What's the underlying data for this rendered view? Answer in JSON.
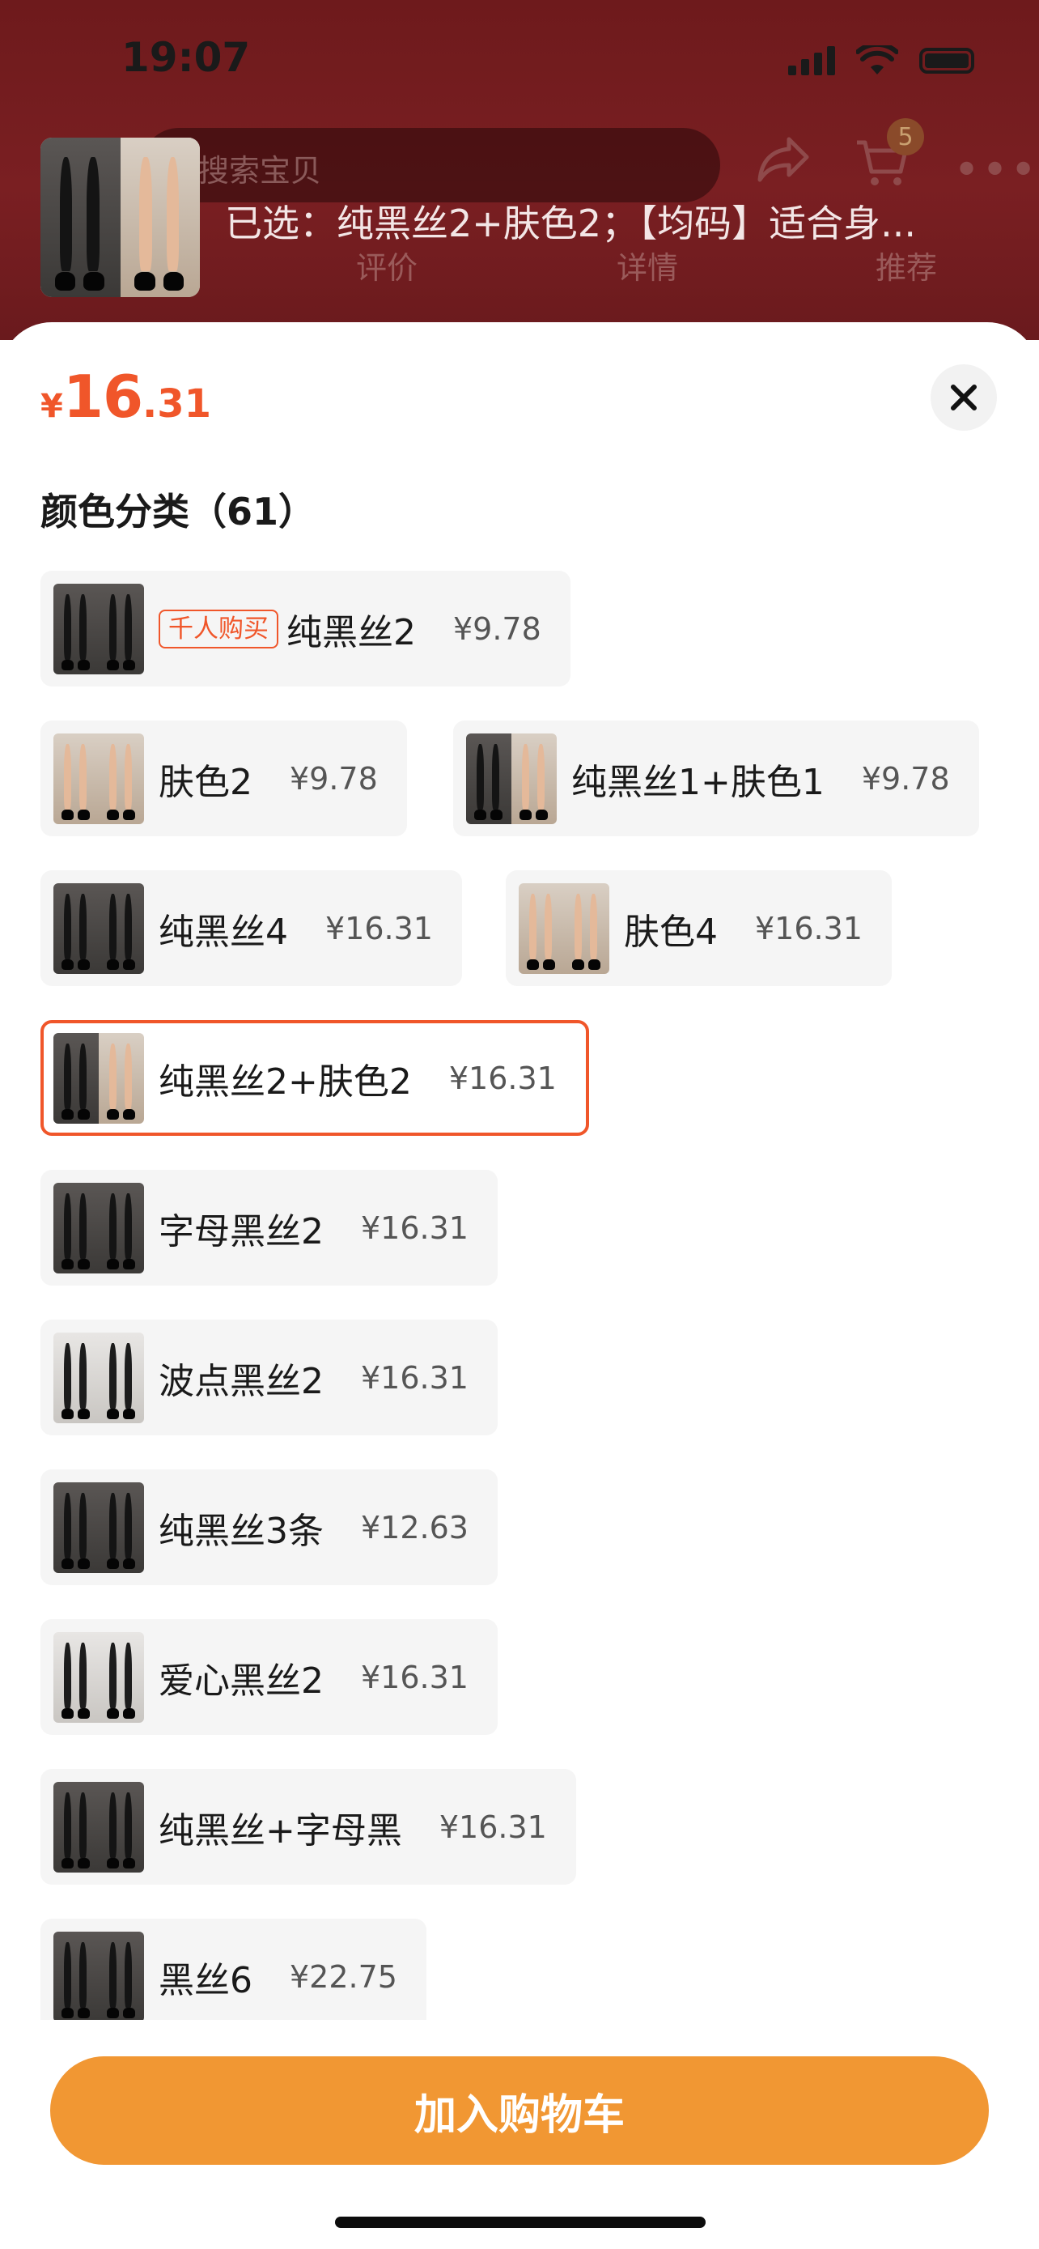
{
  "status_bar": {
    "time": "19:07"
  },
  "background_page": {
    "search_placeholder": "搜索宝贝",
    "cart_count": "5",
    "tabs": [
      "评价",
      "详情",
      "推荐"
    ],
    "selected_summary": "已选：纯黑丝2+肤色2；【均码】适合身..."
  },
  "sheet": {
    "price": {
      "currency": "¥",
      "integer": "16",
      "decimal": ".31"
    },
    "close_icon": "close-icon",
    "section_title": "颜色分类（61）",
    "options": [
      {
        "label": "纯黑丝2",
        "price": "¥9.78",
        "badge": "千人购买",
        "thumb": "dark",
        "selected": false
      },
      {
        "label": "肤色2",
        "price": "¥9.78",
        "badge": "",
        "thumb": "light",
        "selected": false
      },
      {
        "label": "纯黑丝1+肤色1",
        "price": "¥9.78",
        "badge": "",
        "thumb": "mixed",
        "selected": false
      },
      {
        "label": "纯黑丝4",
        "price": "¥16.31",
        "badge": "",
        "thumb": "dark",
        "selected": false
      },
      {
        "label": "肤色4",
        "price": "¥16.31",
        "badge": "",
        "thumb": "light",
        "selected": false
      },
      {
        "label": "纯黑丝2+肤色2",
        "price": "¥16.31",
        "badge": "",
        "thumb": "mixed",
        "selected": true
      },
      {
        "label": "字母黑丝2",
        "price": "¥16.31",
        "badge": "",
        "thumb": "dark",
        "selected": false
      },
      {
        "label": "波点黑丝2",
        "price": "¥16.31",
        "badge": "",
        "thumb": "bw",
        "selected": false
      },
      {
        "label": "纯黑丝3条",
        "price": "¥12.63",
        "badge": "",
        "thumb": "dark",
        "selected": false
      },
      {
        "label": "爱心黑丝2",
        "price": "¥16.31",
        "badge": "",
        "thumb": "bw",
        "selected": false
      },
      {
        "label": "纯黑丝+字母黑",
        "price": "¥16.31",
        "badge": "",
        "thumb": "dark",
        "selected": false
      },
      {
        "label": "黑丝6",
        "price": "¥22.75",
        "badge": "",
        "thumb": "dark",
        "selected": false
      }
    ],
    "add_to_cart_label": "加入购物车"
  },
  "colors": {
    "accent": "#f0562a",
    "cta": "#f19733",
    "option_bg": "#f5f5f5"
  }
}
